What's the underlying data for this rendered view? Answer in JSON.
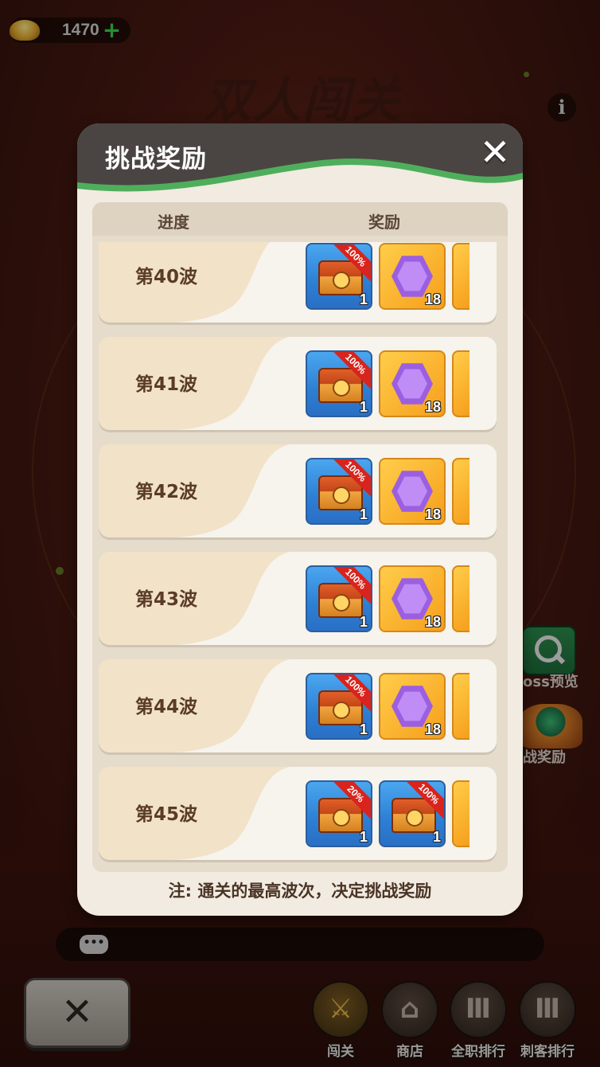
{
  "currency": {
    "value": "1470",
    "icon": "gold-ingot-icon"
  },
  "background": {
    "mode_title": "双人闯关",
    "side_buttons": {
      "boss_preview": "oss预览",
      "challenge_reward": "战奖励"
    },
    "nav": [
      {
        "label": "闯关",
        "icon": "swords-icon",
        "active": true
      },
      {
        "label": "商店",
        "icon": "shop-icon",
        "active": false
      },
      {
        "label": "全职排行",
        "icon": "ranking-icon",
        "active": false
      },
      {
        "label": "刺客排行",
        "icon": "ranking-icon",
        "active": false
      }
    ]
  },
  "dialog": {
    "title": "挑战奖励",
    "headers": {
      "progress": "进度",
      "reward": "奖励"
    },
    "rows": [
      {
        "wave": "第40波",
        "items": [
          {
            "type": "chest",
            "count": "1",
            "badge": "100%"
          },
          {
            "type": "hex",
            "count": "18"
          }
        ]
      },
      {
        "wave": "第41波",
        "items": [
          {
            "type": "chest",
            "count": "1",
            "badge": "100%"
          },
          {
            "type": "hex",
            "count": "18"
          }
        ]
      },
      {
        "wave": "第42波",
        "items": [
          {
            "type": "chest",
            "count": "1",
            "badge": "100%"
          },
          {
            "type": "hex",
            "count": "18"
          }
        ]
      },
      {
        "wave": "第43波",
        "items": [
          {
            "type": "chest",
            "count": "1",
            "badge": "100%"
          },
          {
            "type": "hex",
            "count": "18"
          }
        ]
      },
      {
        "wave": "第44波",
        "items": [
          {
            "type": "chest",
            "count": "1",
            "badge": "100%"
          },
          {
            "type": "hex",
            "count": "18"
          }
        ]
      },
      {
        "wave": "第45波",
        "items": [
          {
            "type": "chest",
            "count": "1",
            "badge": "20%"
          },
          {
            "type": "chest",
            "count": "1",
            "badge": "100%"
          }
        ]
      }
    ],
    "note": "注: 通关的最高波次，决定挑战奖励"
  },
  "colors": {
    "header_dark": "#4a4542",
    "header_green": "#4fae5c",
    "panel": "#f2ebe1",
    "accent_red": "#d8241c"
  }
}
